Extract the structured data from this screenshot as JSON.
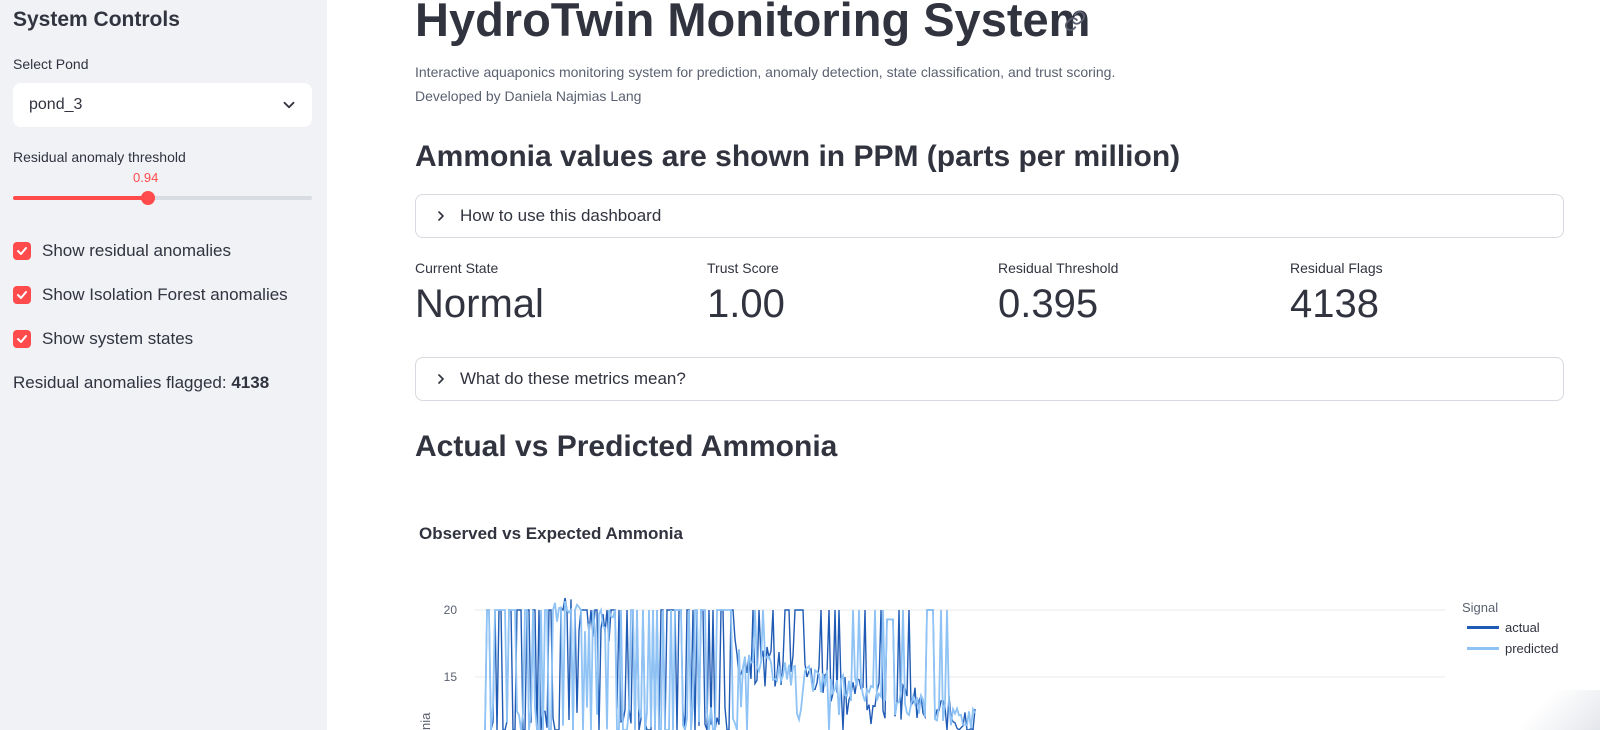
{
  "sidebar": {
    "title": "System Controls",
    "pond_label": "Select Pond",
    "pond_value": "pond_3",
    "threshold_label": "Residual anomaly threshold",
    "threshold_value": "0.94",
    "threshold_fraction": 0.45,
    "checks": [
      {
        "label": "Show residual anomalies",
        "checked": true
      },
      {
        "label": "Show Isolation Forest anomalies",
        "checked": true
      },
      {
        "label": "Show system states",
        "checked": true
      }
    ],
    "flagged_label": "Residual anomalies flagged:",
    "flagged_count": "4138"
  },
  "main": {
    "title": "HydroTwin Monitoring System",
    "description": "Interactive aquaponics monitoring system for prediction, anomaly detection, state classification, and trust scoring.",
    "author": "Developed by Daniela Najmias Lang",
    "units_heading": "Ammonia values are shown in PPM (parts per million)",
    "expander_usage": "How to use this dashboard",
    "expander_metrics": "What do these metrics mean?",
    "metrics": [
      {
        "label": "Current State",
        "value": "Normal"
      },
      {
        "label": "Trust Score",
        "value": "1.00"
      },
      {
        "label": "Residual Threshold",
        "value": "0.395"
      },
      {
        "label": "Residual Flags",
        "value": "4138"
      }
    ],
    "chart_heading": "Actual vs Predicted Ammonia"
  },
  "colors": {
    "accent": "#ff4b4b",
    "sidebar_bg": "#f0f2f6",
    "actual": "#1f5bb5",
    "predicted": "#8fc3f5"
  },
  "chart_data": {
    "type": "line",
    "title": "Observed vs Expected Ammonia",
    "ylabel": "nia",
    "yticks": [
      15,
      20
    ],
    "legend_title": "Signal",
    "legend_position": "top-right",
    "grid": true,
    "series": [
      {
        "name": "actual",
        "color": "#1f5bb5"
      },
      {
        "name": "predicted",
        "color": "#8fc3f5"
      }
    ]
  }
}
